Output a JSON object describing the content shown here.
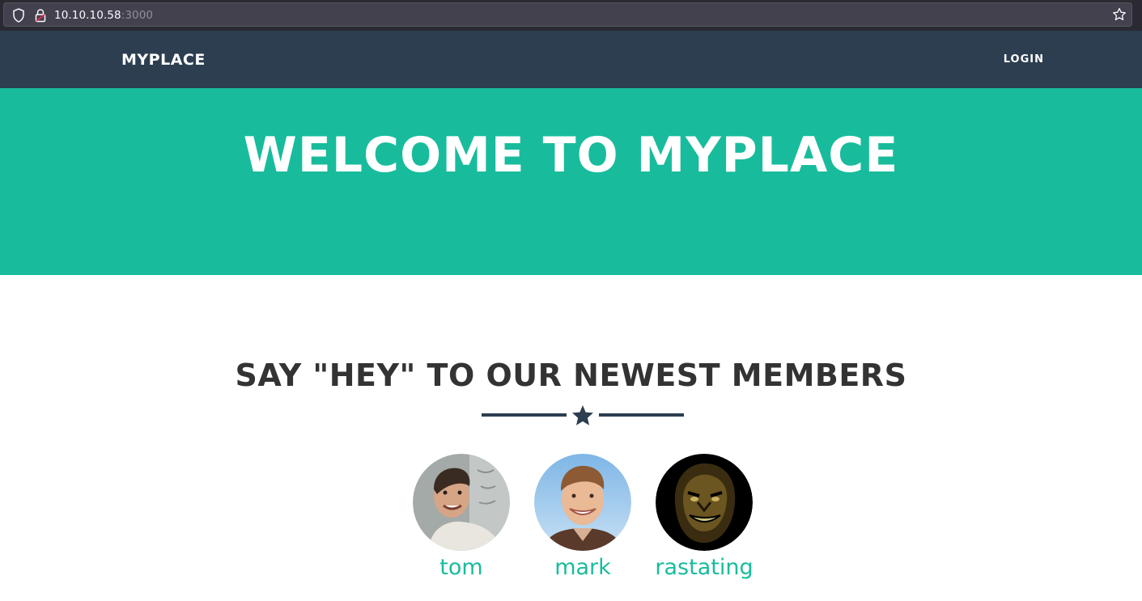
{
  "browser": {
    "url_host": "10.10.10.58",
    "url_port": ":3000",
    "icons": [
      "shield-icon",
      "lock-icon",
      "star-icon"
    ]
  },
  "navbar": {
    "brand": "MYPLACE",
    "login": "LOGIN"
  },
  "hero": {
    "title": "WELCOME TO MYPLACE"
  },
  "members_section": {
    "title": "SAY \"HEY\" TO OUR NEWEST MEMBERS",
    "divider_icon": "star-icon",
    "members": [
      {
        "name": "tom"
      },
      {
        "name": "mark"
      },
      {
        "name": "rastating"
      }
    ]
  },
  "colors": {
    "navbar": "#2c3e50",
    "hero": "#18bc9c",
    "link": "#18bc9c",
    "heading": "#333333"
  }
}
